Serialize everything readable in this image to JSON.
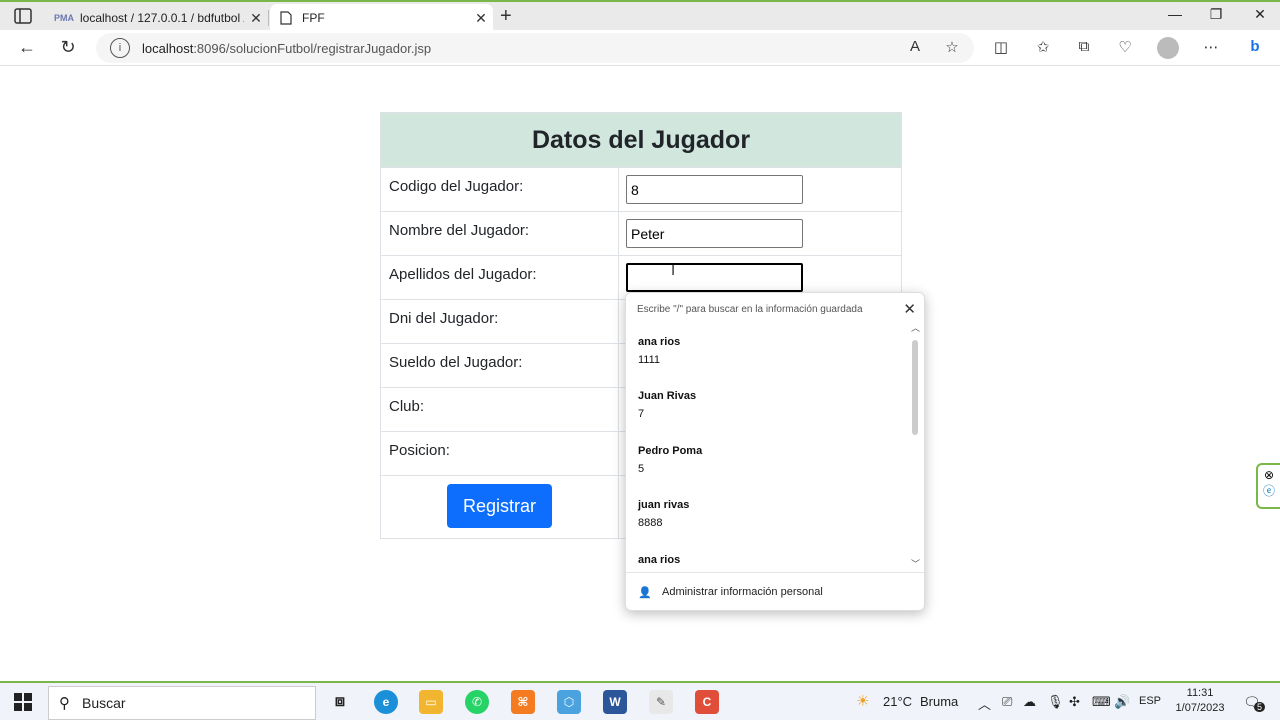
{
  "browser": {
    "tabs": [
      {
        "label": "localhost / 127.0.0.1 / bdfutbol /",
        "favicon": "PMA"
      },
      {
        "label": "FPF"
      }
    ],
    "url_host": "localhost",
    "url_rest": ":8096/solucionFutbol/registrarJugador.jsp"
  },
  "form": {
    "title": "Datos del Jugador",
    "fields": [
      {
        "label": "Codigo del Jugador:",
        "value": "8"
      },
      {
        "label": "Nombre del Jugador:",
        "value": "Peter"
      },
      {
        "label": "Apellidos del Jugador:",
        "value": ""
      },
      {
        "label": "Dni del Jugador:"
      },
      {
        "label": "Sueldo del Jugador:"
      },
      {
        "label": "Club:"
      },
      {
        "label": "Posicion:"
      }
    ],
    "submit_label": "Registrar",
    "header_color": "#d1e7dd",
    "button_color": "#0d6efd"
  },
  "autofill": {
    "hint": "Escribe \"/\" para buscar en la información guardada",
    "items": [
      {
        "name": "ana rios",
        "value": "1111"
      },
      {
        "name": "Juan Rivas",
        "value": "7"
      },
      {
        "name": "Pedro Poma",
        "value": "5"
      },
      {
        "name": "juan rivas",
        "value": "8888"
      },
      {
        "name": "ana rios",
        "value": ""
      }
    ],
    "footer": "Administrar información personal"
  },
  "taskbar": {
    "search_label": "Buscar",
    "weather_temp": "21°C",
    "weather_desc": "Bruma",
    "lang": "ESP",
    "time": "11:31",
    "date": "1/07/2023",
    "notifications": "5"
  }
}
